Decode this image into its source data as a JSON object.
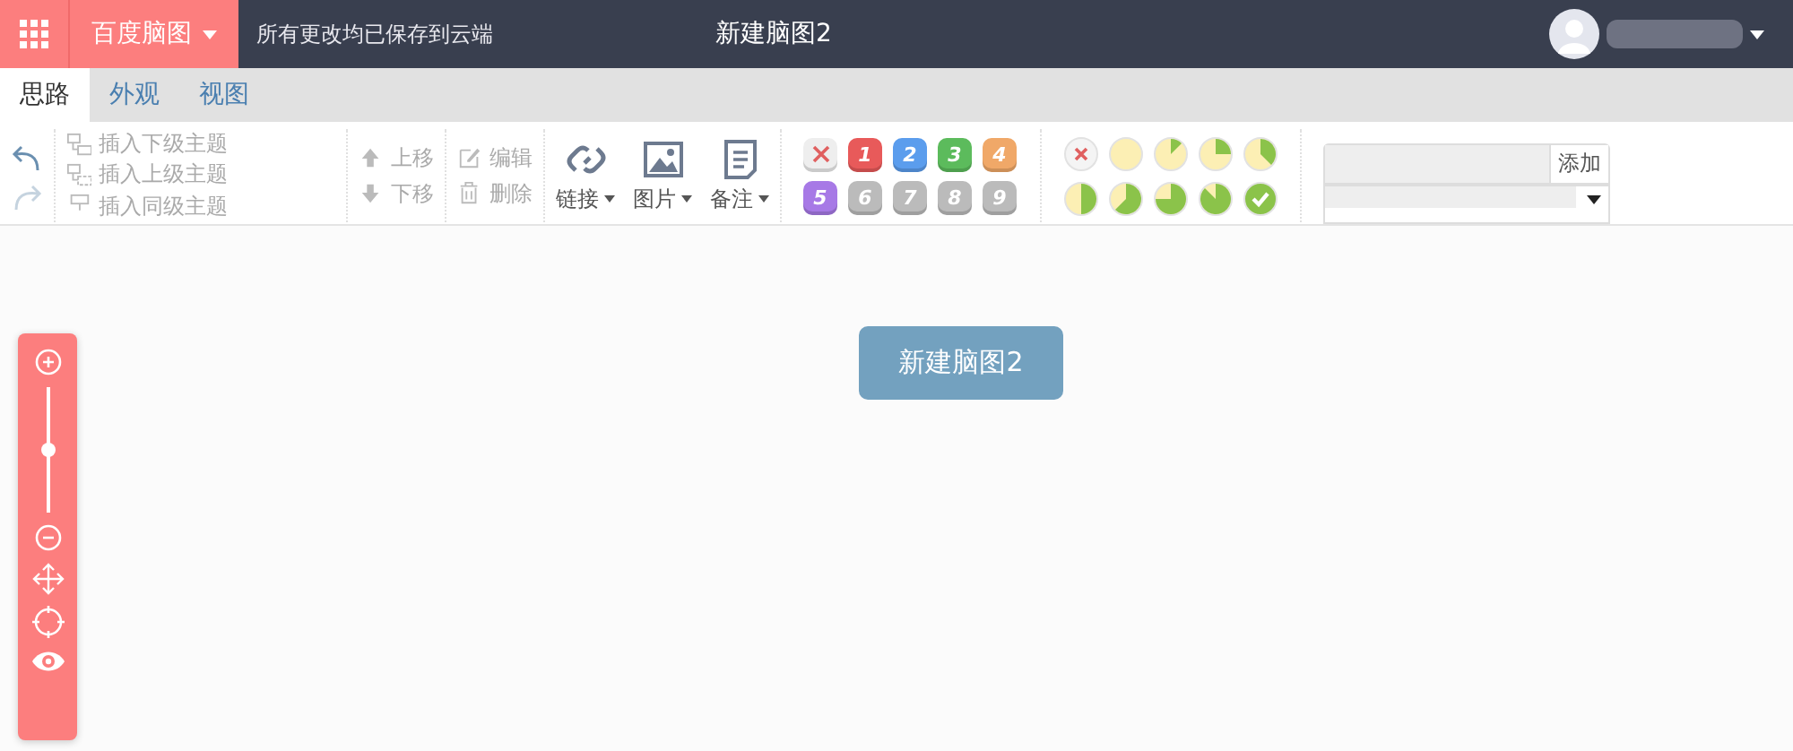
{
  "top_bar": {
    "brand": "百度脑图",
    "save_status": "所有更改均已保存到云端",
    "title": "新建脑图2"
  },
  "tabs": [
    {
      "label": "思路",
      "selected": true
    },
    {
      "label": "外观",
      "selected": false
    },
    {
      "label": "视图",
      "selected": false
    }
  ],
  "toolbar": {
    "insert": [
      "插入下级主题",
      "插入上级主题",
      "插入同级主题"
    ],
    "move": [
      "上移",
      "下移"
    ],
    "edit": [
      "编辑",
      "删除"
    ],
    "media": [
      {
        "kind": "link",
        "label": "链接"
      },
      {
        "kind": "image",
        "label": "图片"
      },
      {
        "kind": "note",
        "label": "备注"
      }
    ],
    "priorities": [
      {
        "kind": "clear",
        "color": "#eeeeee"
      },
      {
        "kind": "number",
        "label": "1",
        "color": "#e85a5a"
      },
      {
        "kind": "number",
        "label": "2",
        "color": "#5b9ded"
      },
      {
        "kind": "number",
        "label": "3",
        "color": "#5cbb5c"
      },
      {
        "kind": "number",
        "label": "4",
        "color": "#f0a868"
      },
      {
        "kind": "number",
        "label": "5",
        "color": "#a779e6"
      },
      {
        "kind": "number",
        "label": "6",
        "color": "#bbbbbb"
      },
      {
        "kind": "number",
        "label": "7",
        "color": "#bbbbbb"
      },
      {
        "kind": "number",
        "label": "8",
        "color": "#bbbbbb"
      },
      {
        "kind": "number",
        "label": "9",
        "color": "#bbbbbb"
      }
    ],
    "progress": [
      {
        "kind": "clear"
      },
      {
        "kind": "empty"
      },
      {
        "kind": "eighth"
      },
      {
        "kind": "quarter"
      },
      {
        "kind": "three-eighths"
      },
      {
        "kind": "half"
      },
      {
        "kind": "five-eighths"
      },
      {
        "kind": "three-quarters"
      },
      {
        "kind": "seven-eighths"
      },
      {
        "kind": "done"
      }
    ],
    "tag_add_button": "添加"
  },
  "canvas": {
    "root_node": "新建脑图2"
  },
  "zoom_panel": {
    "level": 0.5
  }
}
